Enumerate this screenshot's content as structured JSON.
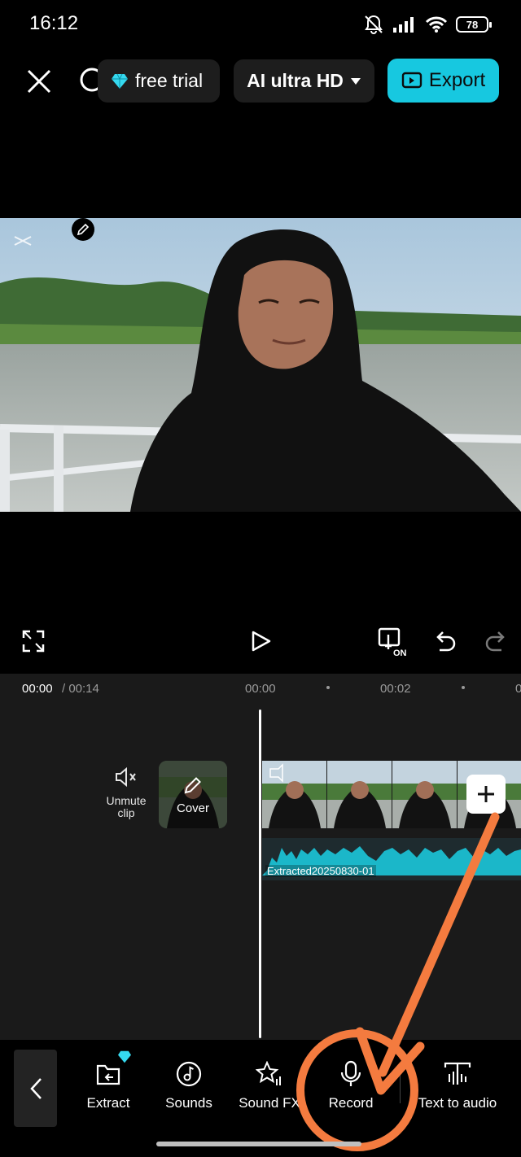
{
  "status_bar": {
    "time": "16:12",
    "battery": "78"
  },
  "header": {
    "free_trial_label": "free trial",
    "quality_label": "AI ultra HD",
    "export_label": "Export"
  },
  "timeline": {
    "current_time": "00:00",
    "total_time": "/ 00:14",
    "ruler": [
      "00:00",
      "00:02"
    ],
    "unmute_label": "Unmute clip",
    "cover_label": "Cover",
    "audio_clip_name": "Extracted20250830-01"
  },
  "tools": [
    {
      "label": "Extract",
      "icon": "extract-icon",
      "premium": true
    },
    {
      "label": "Sounds",
      "icon": "music-note-icon"
    },
    {
      "label": "Sound FX",
      "icon": "sparkle-star-icon"
    },
    {
      "label": "Record",
      "icon": "microphone-icon"
    },
    {
      "label": "Text to audio",
      "icon": "text-to-audio-icon"
    }
  ],
  "colors": {
    "accent": "#17c8e0",
    "annotation": "#f47b3f",
    "audio_wave": "#1bb7c9"
  }
}
